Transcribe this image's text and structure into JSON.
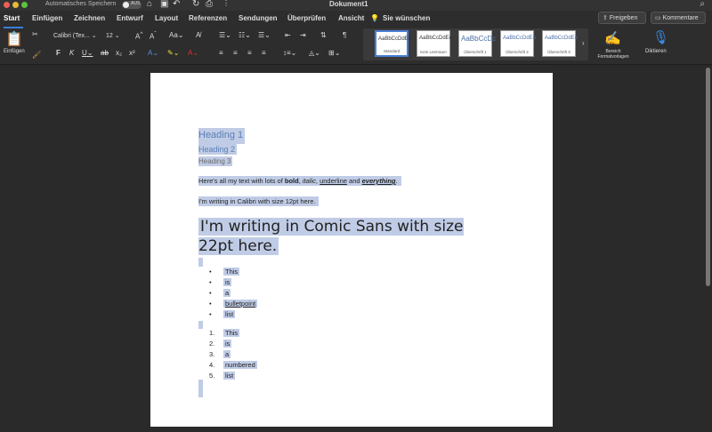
{
  "titlebar": {
    "autosave_label": "Automatisches Speichern",
    "autosave_state": "AUS",
    "doc_title": "Dokument1"
  },
  "menu": {
    "tabs": [
      "Start",
      "Einfügen",
      "Zeichnen",
      "Entwurf",
      "Layout",
      "Referenzen",
      "Sendungen",
      "Überprüfen",
      "Ansicht"
    ],
    "tell_me": "Sie wünschen",
    "share": "Freigeben",
    "comments": "Kommentare"
  },
  "ribbon": {
    "paste_label": "Einfügen",
    "font_name": "Calibri (Tex...",
    "font_size": "12",
    "styles": [
      {
        "preview": "AaBbCcDdEe",
        "name": "Standard"
      },
      {
        "preview": "AaBbCcDdEe",
        "name": "Kein Leerraum"
      },
      {
        "preview": "AaBbCcDc",
        "name": "Überschrift 1"
      },
      {
        "preview": "AaBbCcDdEe",
        "name": "Überschrift 2"
      },
      {
        "preview": "AaBbCcDdEe",
        "name": "Überschrift 3"
      }
    ],
    "styles_pane_label": "Bereich Formatvorlagen",
    "dictate_label": "Diktieren"
  },
  "document": {
    "heading1": "Heading 1",
    "heading2": "Heading 2",
    "heading3": "Heading 3",
    "para1": {
      "pre": "Here's all my text with lots of ",
      "bold": "bold",
      "sep1": ", ",
      "italic": "italic",
      "sep2": ", ",
      "underline": "underline",
      "sep3": " and ",
      "everything": "everything",
      "end": "."
    },
    "para2": "I'm writing in Calibri with size 12pt here.",
    "comic": "I'm writing in Comic Sans with size 22pt here.",
    "bullets": [
      "This",
      "is",
      "a",
      "bulletpoint",
      "list"
    ],
    "numbered": [
      "This",
      "is",
      "a",
      "numbered",
      "list"
    ]
  }
}
